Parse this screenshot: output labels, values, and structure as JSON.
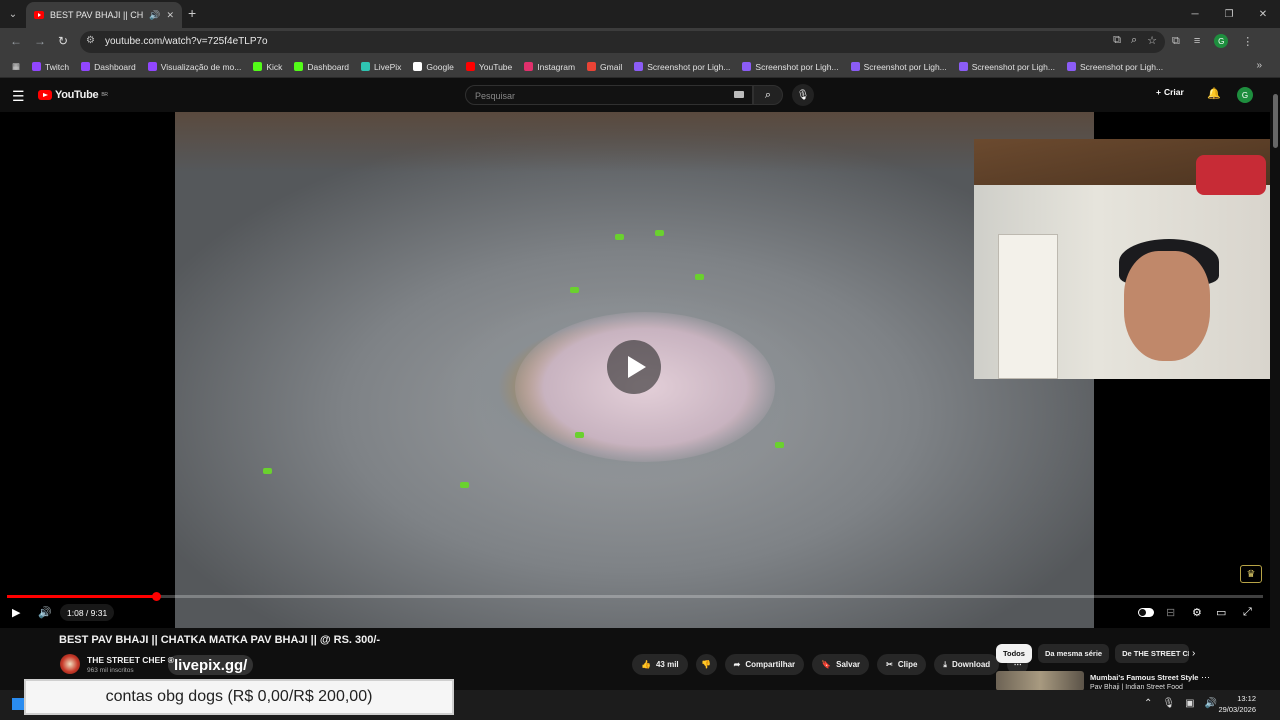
{
  "browser": {
    "tab_title": "BEST PAV BHAJI || CHATKA MATKA",
    "url": "youtube.com/watch?v=725f4eTLP7o",
    "bookmarks": [
      {
        "label": "Twitch",
        "color": "#9146ff"
      },
      {
        "label": "Dashboard",
        "color": "#9146ff"
      },
      {
        "label": "Visualização de mo...",
        "color": "#9146ff"
      },
      {
        "label": "Kick",
        "color": "#53fc18"
      },
      {
        "label": "Dashboard",
        "color": "#53fc18"
      },
      {
        "label": "LivePix",
        "color": "#2fc4b2"
      },
      {
        "label": "Google",
        "color": "#ffffff"
      },
      {
        "label": "YouTube",
        "color": "#ff0000"
      },
      {
        "label": "Instagram",
        "color": "#e1306c"
      },
      {
        "label": "Gmail",
        "color": "#ea4335"
      },
      {
        "label": "Screenshot por Ligh...",
        "color": "#8b5cf6"
      },
      {
        "label": "Screenshot por Ligh...",
        "color": "#8b5cf6"
      },
      {
        "label": "Screenshot por Ligh...",
        "color": "#8b5cf6"
      },
      {
        "label": "Screenshot por Ligh...",
        "color": "#8b5cf6"
      },
      {
        "label": "Screenshot por Ligh...",
        "color": "#8b5cf6"
      }
    ],
    "profile_initial": "G"
  },
  "youtube": {
    "logo_text": "YouTube",
    "logo_super": "BR",
    "search_placeholder": "Pesquisar",
    "create_label": "Criar",
    "avatar_initial": "G"
  },
  "player": {
    "time": "1:08 / 9:31",
    "progress_fraction": 0.119
  },
  "video": {
    "title": "BEST PAV BHAJI || CHATKA MATKA PAV BHAJI || @ RS. 300/-",
    "channel_name": "THE STREET CHEF ®",
    "subscribers": "963 mil inscritos",
    "overlay_tag": "livepix.gg/",
    "likes": "43 mil",
    "share_label": "Compartilhar",
    "save_label": "Salvar",
    "clip_label": "Clipe",
    "download_label": "Download"
  },
  "sidebar": {
    "chips": [
      "Todos",
      "Da mesma série",
      "De THE STREET CHEF"
    ],
    "rec_title": "Mumbai's Famous Street Style",
    "rec_subtitle": "Pav Bhaji | Indian Street Food"
  },
  "donation": {
    "text": "contas obg dogs (R$ 0,00/R$ 200,00)"
  },
  "taskbar": {
    "time": "13:12",
    "date": "29/03/2026"
  }
}
